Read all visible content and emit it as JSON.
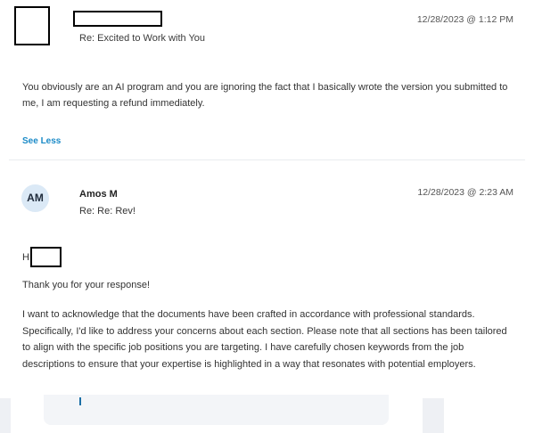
{
  "message1": {
    "subject": "Re: Excited to Work with You",
    "timestamp": "12/28/2023 @ 1:12 PM",
    "body": "You obviously are an AI program and you are ignoring the fact that I basically wrote the version you submitted to me, I am requesting a refund immediately.",
    "toggle_label": "See Less"
  },
  "message2": {
    "avatar_initials": "AM",
    "sender": "Amos M",
    "subject": "Re: Re: Rev!",
    "timestamp": "12/28/2023 @ 2:23 AM",
    "greeting_prefix": "H",
    "thanks": "Thank you for your response!",
    "paragraph": "I want to acknowledge that the documents have been crafted in accordance with professional standards. Specifically, I'd like to address your concerns about each section. Please note that all sections has been tailored to align with the specific job positions you are targeting. I have carefully chosen keywords from the job descriptions to ensure that your expertise is highlighted in a way that resonates with potential employers."
  }
}
